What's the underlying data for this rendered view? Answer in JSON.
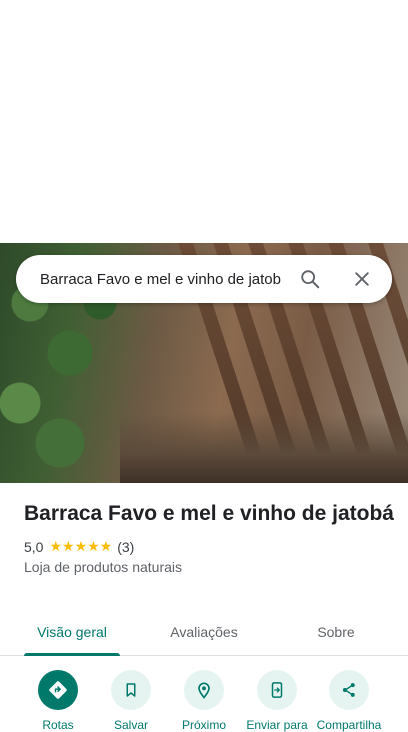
{
  "search": {
    "query": "Barraca Favo e mel e vinho de jatob",
    "search_icon": "search-icon",
    "close_icon": "close-icon"
  },
  "place": {
    "name": "Barraca Favo e mel e vinho de jatobá",
    "rating": "5,0",
    "stars": "★★★★★",
    "review_count": "(3)",
    "category": "Loja de produtos naturais"
  },
  "tabs": [
    {
      "label": "Visão geral",
      "active": true
    },
    {
      "label": "Avaliações",
      "active": false
    },
    {
      "label": "Sobre",
      "active": false
    }
  ],
  "actions": [
    {
      "label": "Rotas",
      "icon": "directions-icon"
    },
    {
      "label": "Salvar",
      "icon": "bookmark-icon"
    },
    {
      "label": "Próximo",
      "icon": "nearby-icon"
    },
    {
      "label": "Enviar para",
      "icon": "send-to-phone-icon"
    },
    {
      "label": "Compartilha",
      "icon": "share-icon"
    }
  ],
  "colors": {
    "accent": "#00796b",
    "star": "#fbbc04",
    "action_bg": "#e6f4f1"
  }
}
